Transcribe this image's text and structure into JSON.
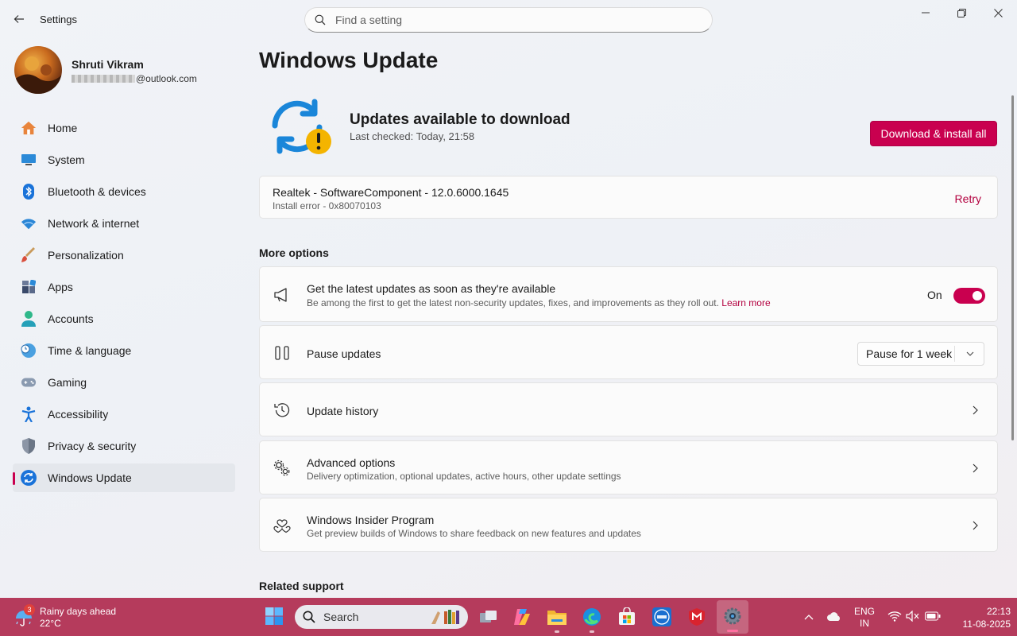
{
  "window": {
    "title": "Settings"
  },
  "search": {
    "placeholder": "Find a setting"
  },
  "profile": {
    "name": "Shruti Vikram",
    "email_domain": "@outlook.com"
  },
  "nav": {
    "items": [
      {
        "label": "Home"
      },
      {
        "label": "System"
      },
      {
        "label": "Bluetooth & devices"
      },
      {
        "label": "Network & internet"
      },
      {
        "label": "Personalization"
      },
      {
        "label": "Apps"
      },
      {
        "label": "Accounts"
      },
      {
        "label": "Time & language"
      },
      {
        "label": "Gaming"
      },
      {
        "label": "Accessibility"
      },
      {
        "label": "Privacy & security"
      },
      {
        "label": "Windows Update",
        "active": true
      }
    ]
  },
  "main": {
    "title": "Windows Update",
    "status_title": "Updates available to download",
    "status_sub": "Last checked: Today, 21:58",
    "download_button": "Download & install all",
    "update_item": {
      "name": "Realtek - SoftwareComponent - 12.0.6000.1645",
      "error": "Install error - 0x80070103",
      "action": "Retry"
    },
    "more_options_header": "More options",
    "latest": {
      "title": "Get the latest updates as soon as they're available",
      "desc": "Be among the first to get the latest non-security updates, fixes, and improvements as they roll out.",
      "link": "Learn more",
      "state": "On"
    },
    "pause": {
      "title": "Pause updates",
      "selected": "Pause for 1 week"
    },
    "history": {
      "title": "Update history"
    },
    "advanced": {
      "title": "Advanced options",
      "desc": "Delivery optimization, optional updates, active hours, other update settings"
    },
    "insider": {
      "title": "Windows Insider Program",
      "desc": "Get preview builds of Windows to share feedback on new features and updates"
    },
    "related_header": "Related support"
  },
  "taskbar": {
    "weather": {
      "badge": "3",
      "text": "Rainy days ahead",
      "temp": "22°C"
    },
    "search_label": "Search",
    "language": {
      "line1": "ENG",
      "line2": "IN"
    },
    "time": "22:13",
    "date": "11-08-2025"
  },
  "colors": {
    "accent": "#c9004f",
    "taskbar": "#b53b5c"
  }
}
